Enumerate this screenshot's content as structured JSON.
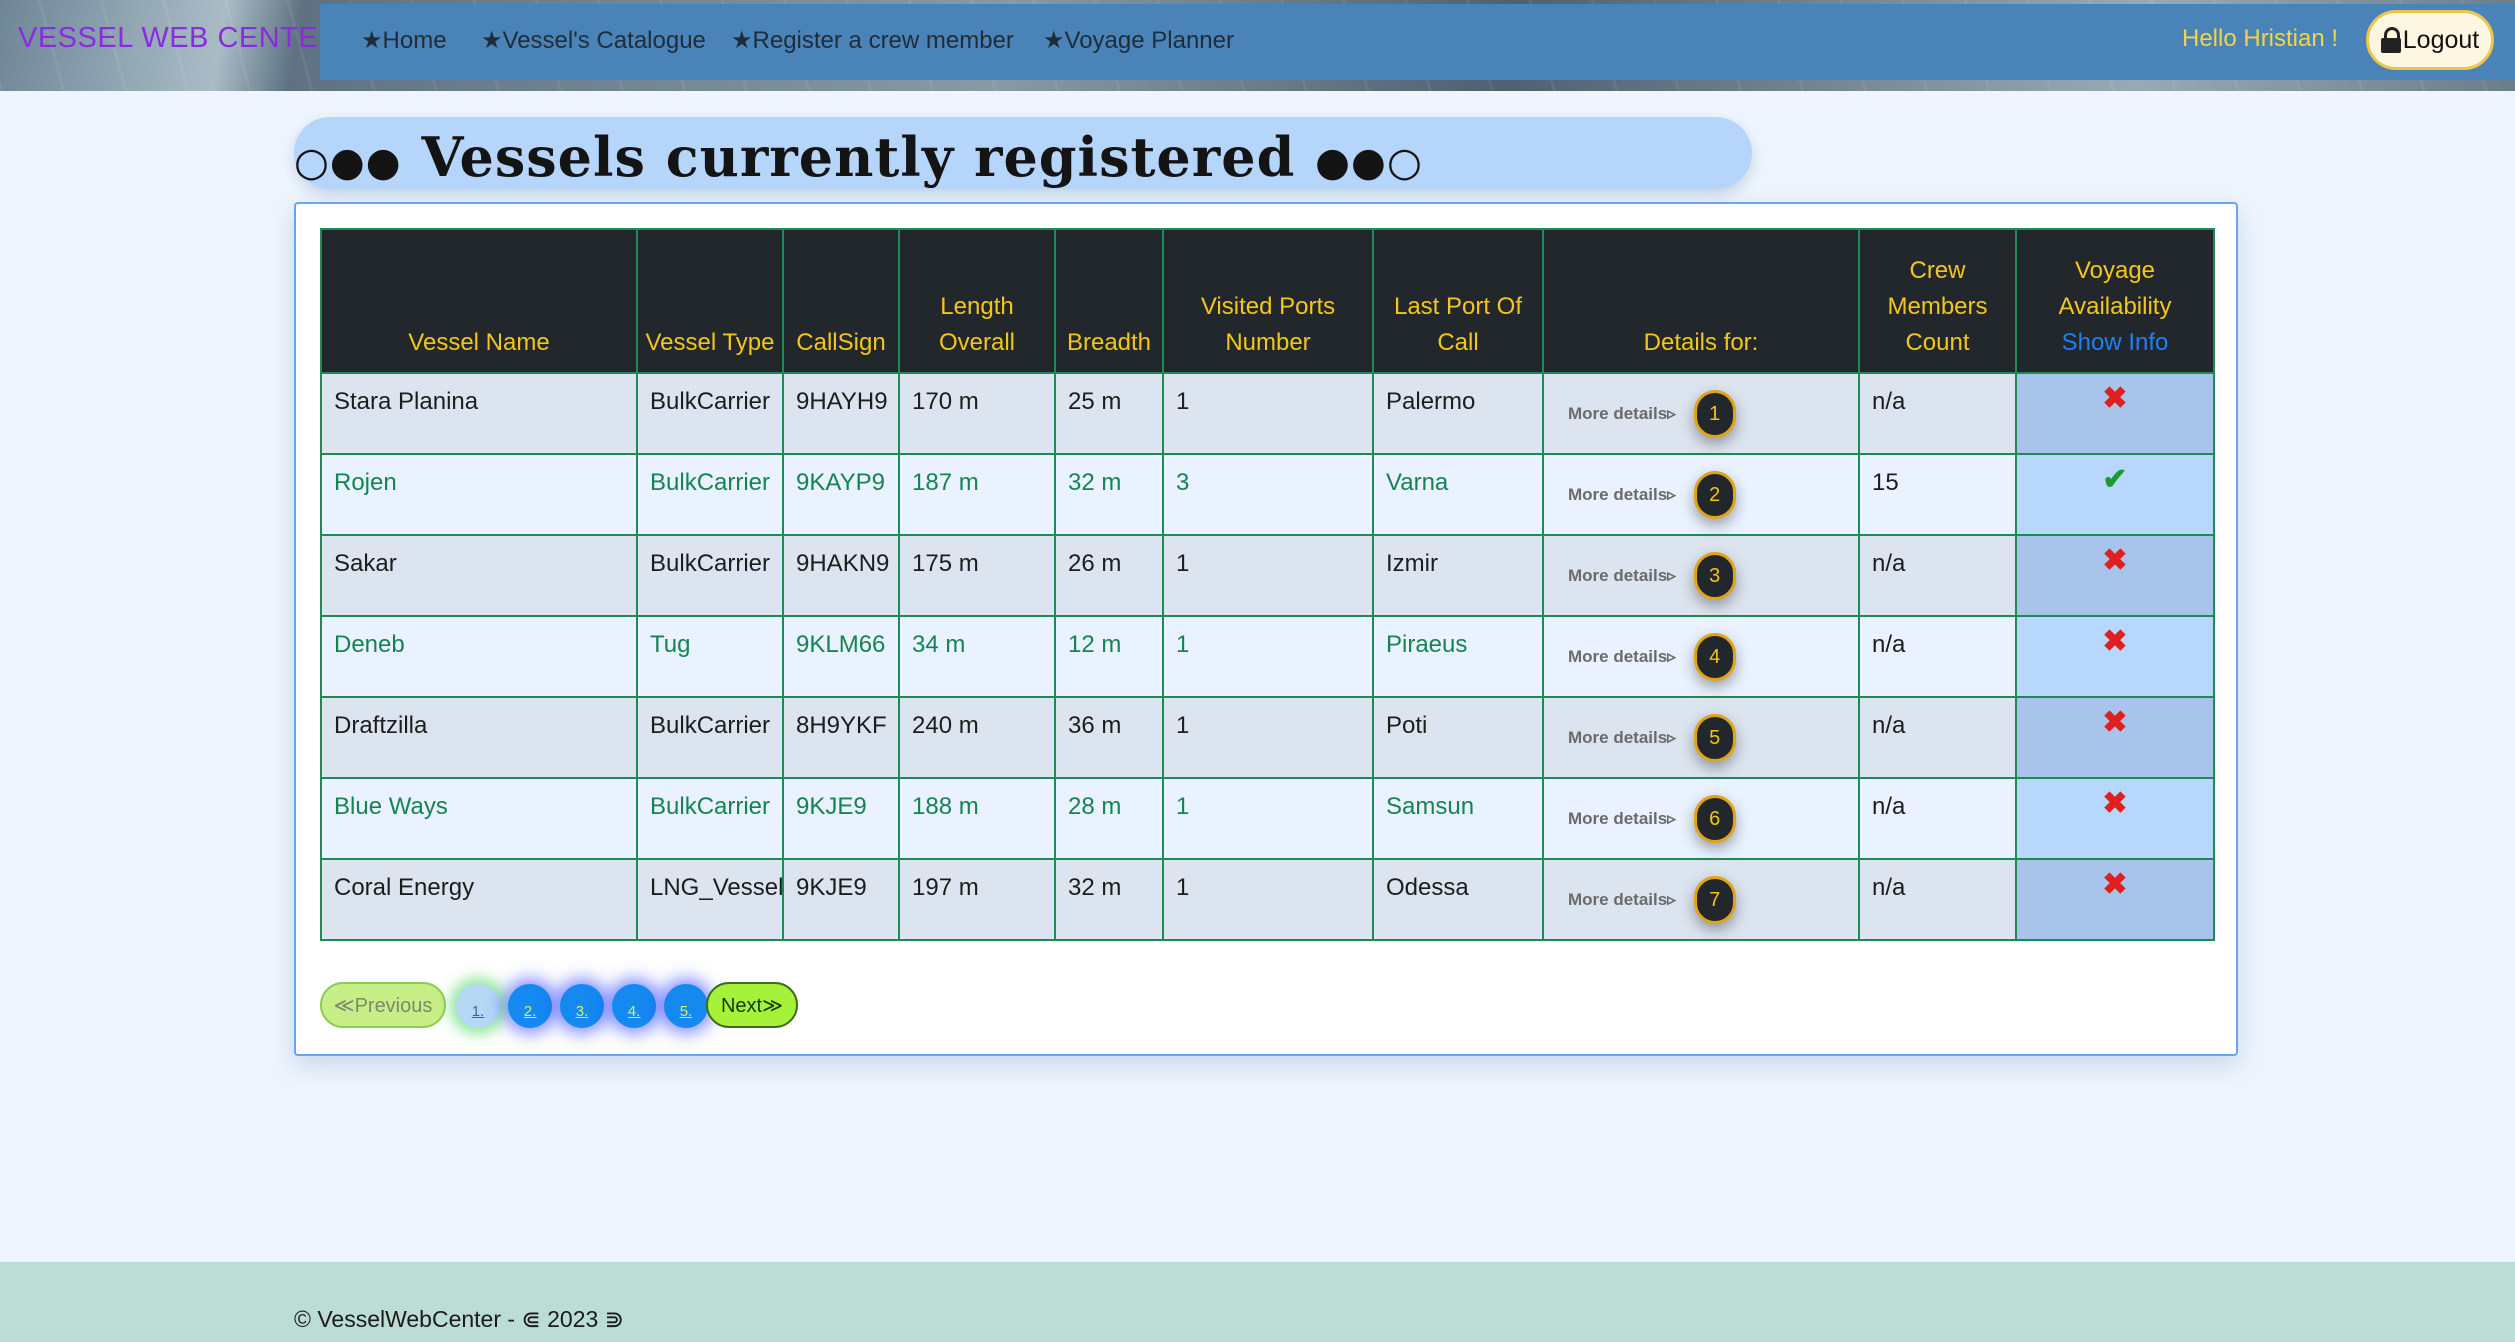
{
  "app": {
    "brand": "VESSEL WEB CENTER"
  },
  "nav": {
    "items": [
      {
        "label": "★Home"
      },
      {
        "label": "★Vessel's Catalogue"
      },
      {
        "label": "★Register a crew member"
      },
      {
        "label": "★Voyage Planner"
      }
    ],
    "greeting": "Hello Hristian !",
    "logout_label": "Logout"
  },
  "page": {
    "title": "Vessels currently registered",
    "title_deco_left": "○●●",
    "title_deco_right": "●●○"
  },
  "table": {
    "headers": {
      "vessel_name": "Vessel Name",
      "vessel_type": "Vessel Type",
      "callsign": "CallSign",
      "length": "Length Overall",
      "breadth": "Breadth",
      "visited_ports": "Visited Ports Number",
      "last_port": "Last Port Of Call",
      "details": "Details for:",
      "crew_count": "Crew Members Count",
      "availability": "Voyage Availability",
      "show_info": "Show Info"
    },
    "more_details_label": "More details▹",
    "rows": [
      {
        "name": "Stara Planina",
        "type": "BulkCarrier",
        "callsign": "9HAYH9",
        "length": "170 m",
        "breadth": "25 m",
        "ports": "1",
        "last_port": "Palermo",
        "badge": "1",
        "crew": "n/a",
        "available": false
      },
      {
        "name": "Rojen",
        "type": "BulkCarrier",
        "callsign": "9KAYP9",
        "length": "187 m",
        "breadth": "32 m",
        "ports": "3",
        "last_port": "Varna",
        "badge": "2",
        "crew": "15",
        "available": true
      },
      {
        "name": "Sakar",
        "type": "BulkCarrier",
        "callsign": "9HAKN9",
        "length": "175 m",
        "breadth": "26 m",
        "ports": "1",
        "last_port": "Izmir",
        "badge": "3",
        "crew": "n/a",
        "available": false
      },
      {
        "name": "Deneb",
        "type": "Tug",
        "callsign": "9KLM66",
        "length": "34 m",
        "breadth": "12 m",
        "ports": "1",
        "last_port": "Piraeus",
        "badge": "4",
        "crew": "n/a",
        "available": false
      },
      {
        "name": "Draftzilla",
        "type": "BulkCarrier",
        "callsign": "8H9YKF",
        "length": "240 m",
        "breadth": "36 m",
        "ports": "1",
        "last_port": "Poti",
        "badge": "5",
        "crew": "n/a",
        "available": false
      },
      {
        "name": "Blue Ways",
        "type": "BulkCarrier",
        "callsign": "9KJE9",
        "length": "188 m",
        "breadth": "28 m",
        "ports": "1",
        "last_port": "Samsun",
        "badge": "6",
        "crew": "n/a",
        "available": false
      },
      {
        "name": "Coral Energy",
        "type": "LNG_Vessel",
        "callsign": "9KJE9",
        "length": "197 m",
        "breadth": "32 m",
        "ports": "1",
        "last_port": "Odessa",
        "badge": "7",
        "crew": "n/a",
        "available": false
      }
    ],
    "available_icon": "check-icon",
    "unavailable_icon": "cross-icon"
  },
  "pagination": {
    "prev_label": "≪Previous",
    "next_label": "Next≫",
    "pages": [
      "1.",
      "2.",
      "3.",
      "4.",
      "5."
    ],
    "current": "1."
  },
  "footer": {
    "text": "© VesselWebCenter - ⋐ 2023 ⋑"
  },
  "colors": {
    "nav_panel": "#4a83b7",
    "brand": "#8a2be2",
    "header_bg": "#22272b",
    "header_text": "#f3c61b",
    "accent_green": "#158451",
    "footer_bg": "#bbddd4"
  }
}
